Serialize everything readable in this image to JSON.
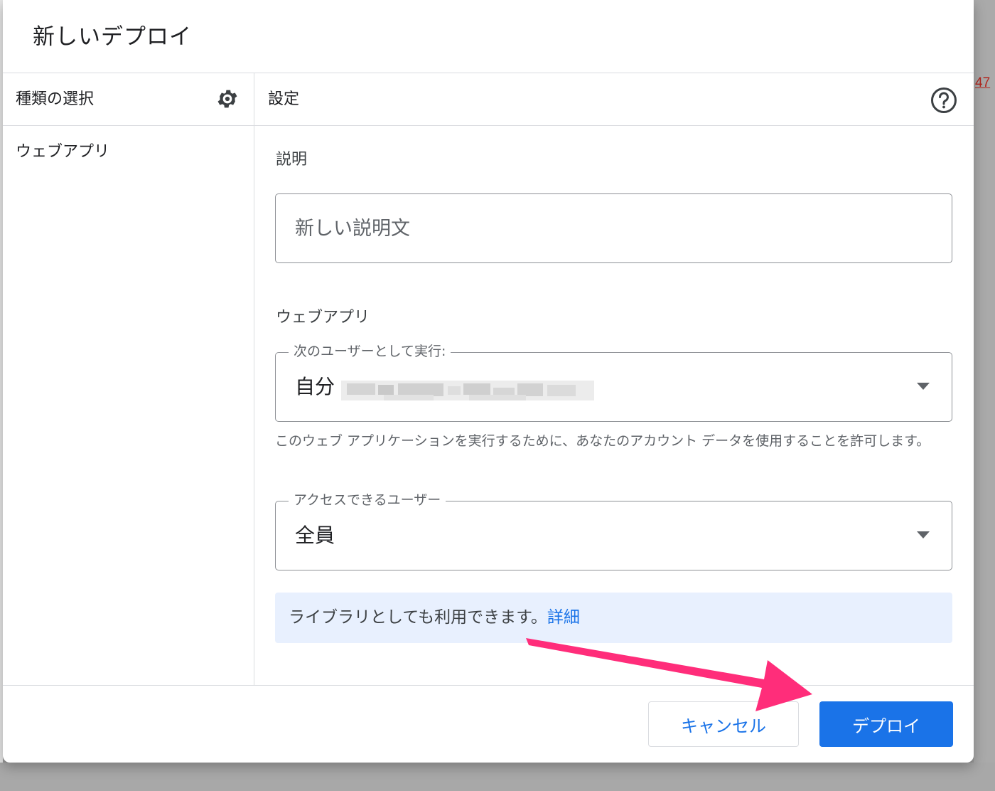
{
  "background": {
    "fragment_text": "47"
  },
  "dialog": {
    "title": "新しいデプロイ"
  },
  "left_panel": {
    "header_label": "種類の選択",
    "settings_icon": "gear-icon",
    "items": [
      {
        "label": "ウェブアプリ"
      }
    ]
  },
  "right_panel": {
    "header_label": "設定",
    "help_icon": "help-circle-icon",
    "description": {
      "label": "説明",
      "value": "",
      "placeholder": "新しい説明文"
    },
    "web_app": {
      "section_label": "ウェブアプリ",
      "execute_as": {
        "label": "次のユーザーとして実行:",
        "value": "自分"
      },
      "helper_text": "このウェブ アプリケーションを実行するために、あなたのアカウント データを使用することを許可します。",
      "access": {
        "label": "アクセスできるユーザー",
        "value": "全員"
      }
    },
    "info": {
      "text": "ライブラリとしても利用できます。",
      "link_label": "詳細"
    }
  },
  "footer": {
    "cancel_label": "キャンセル",
    "deploy_label": "デプロイ"
  },
  "colors": {
    "primary": "#1a73e8",
    "info_background": "#e8f0fe",
    "annotation_arrow": "#ff2d7a"
  }
}
